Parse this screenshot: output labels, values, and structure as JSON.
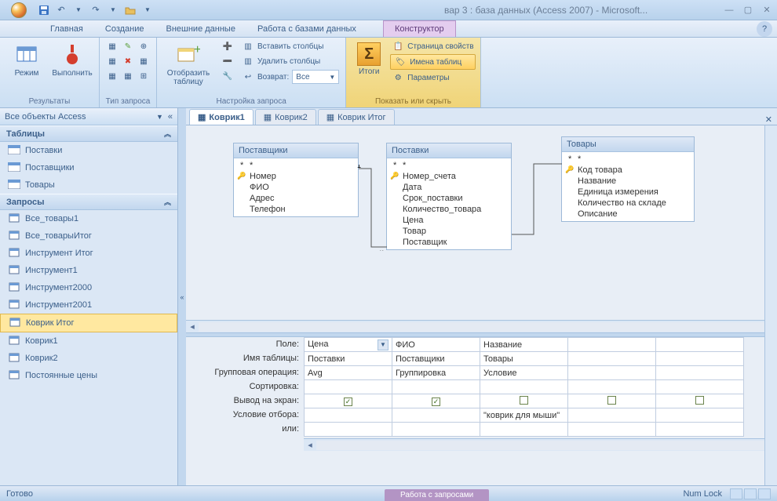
{
  "window_title": "вар 3 : база данных (Access 2007) - Microsoft...",
  "context_title": "Работа с запросами",
  "tabs": {
    "main": "Главная",
    "create": "Создание",
    "external": "Внешние данные",
    "dbtools": "Работа с базами данных",
    "designer": "Конструктор"
  },
  "ribbon": {
    "results": {
      "view": "Режим",
      "run": "Выполнить",
      "title": "Результаты"
    },
    "qtype": {
      "title": "Тип запроса"
    },
    "setup": {
      "showtable": "Отобразить\nтаблицу",
      "insert_cols": "Вставить столбцы",
      "delete_cols": "Удалить столбцы",
      "return_label": "Возврат:",
      "return_value": "Все",
      "title": "Настройка запроса"
    },
    "showhide": {
      "totals": "Итоги",
      "prop_page": "Страница свойств",
      "table_names": "Имена таблиц",
      "params": "Параметры",
      "title": "Показать или скрыть"
    }
  },
  "nav": {
    "header": "Все объекты Access",
    "group_tables": "Таблицы",
    "group_queries": "Запросы",
    "tables": [
      "Поставки",
      "Поставщики",
      "Товары"
    ],
    "queries": [
      "Все_товары1",
      "Все_товарыИтог",
      "Инструмент Итог",
      "Инструмент1",
      "Инструмент2000",
      "Инструмент2001",
      "Коврик Итог",
      "Коврик1",
      "Коврик2",
      "Постоянные цены"
    ]
  },
  "doc_tabs": [
    "Коврик1",
    "Коврик2",
    "Коврик Итог"
  ],
  "diagram": {
    "suppliers": {
      "title": "Поставщики",
      "fields": [
        "*",
        "Номер",
        "ФИО",
        "Адрес",
        "Телефон"
      ],
      "key": 1
    },
    "deliveries": {
      "title": "Поставки",
      "fields": [
        "*",
        "Номер_счета",
        "Дата",
        "Срок_поставки",
        "Количество_товара",
        "Цена",
        "Товар",
        "Поставщик"
      ],
      "key": 1
    },
    "goods": {
      "title": "Товары",
      "fields": [
        "*",
        "Код товара",
        "Название",
        "Единица измерения",
        "Количество на складе",
        "Описание"
      ],
      "key": 1
    }
  },
  "grid": {
    "labels": [
      "Поле:",
      "Имя таблицы:",
      "Групповая операция:",
      "Сортировка:",
      "Вывод на экран:",
      "Условие отбора:",
      "или:"
    ],
    "cols": [
      {
        "field": "Цена",
        "table": "Поставки",
        "group": "Avg",
        "show": true,
        "crit": ""
      },
      {
        "field": "ФИО",
        "table": "Поставщики",
        "group": "Группировка",
        "show": true,
        "crit": ""
      },
      {
        "field": "Название",
        "table": "Товары",
        "group": "Условие",
        "show": false,
        "crit": "\"коврик для мыши\""
      },
      {
        "field": "",
        "table": "",
        "group": "",
        "show": false,
        "crit": ""
      },
      {
        "field": "",
        "table": "",
        "group": "",
        "show": false,
        "crit": ""
      }
    ]
  },
  "status": {
    "ready": "Готово",
    "numlock": "Num Lock"
  }
}
